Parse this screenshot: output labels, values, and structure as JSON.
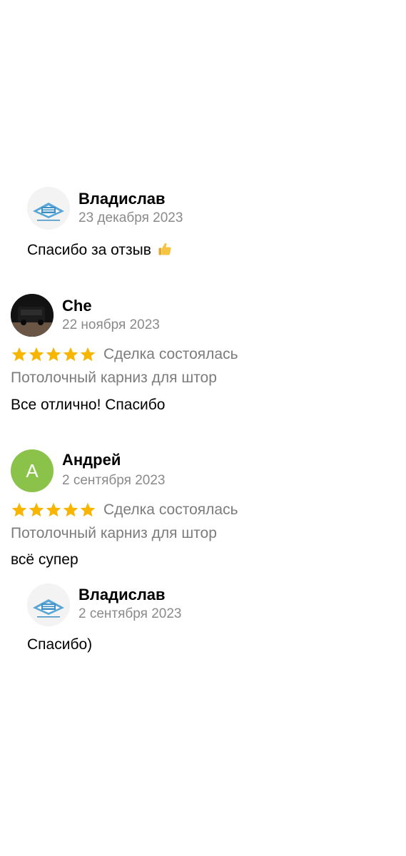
{
  "colors": {
    "star": "#f7b500",
    "letter_avatar_bg": "#8bc34a",
    "muted_text": "#8a8a8a",
    "logo_blue": "#3d8fc4"
  },
  "icons": {
    "company_logo": "company-logo-icon",
    "thumbs_up": "thumbs-up-emoji-icon",
    "star": "star-icon"
  },
  "reviews": [
    {
      "type": "reply",
      "name": "Владислав",
      "date": "23 декабря 2023",
      "text": "Спасибо за отзыв"
    },
    {
      "type": "review",
      "name": "Che",
      "date": "22 ноября 2023",
      "rating": 5,
      "deal_status": "Сделка состоялась",
      "product": "Потолочный карниз для штор",
      "text": "Все отлично! Спасибо"
    },
    {
      "type": "review",
      "name": "Андрей",
      "avatar_letter": "А",
      "date": "2 сентября 2023",
      "rating": 5,
      "deal_status": "Сделка состоялась",
      "product": "Потолочный карниз для штор",
      "text": "всё супер"
    },
    {
      "type": "reply",
      "name": "Владислав",
      "date": "2 сентября 2023",
      "text": "Спасибо)"
    }
  ]
}
